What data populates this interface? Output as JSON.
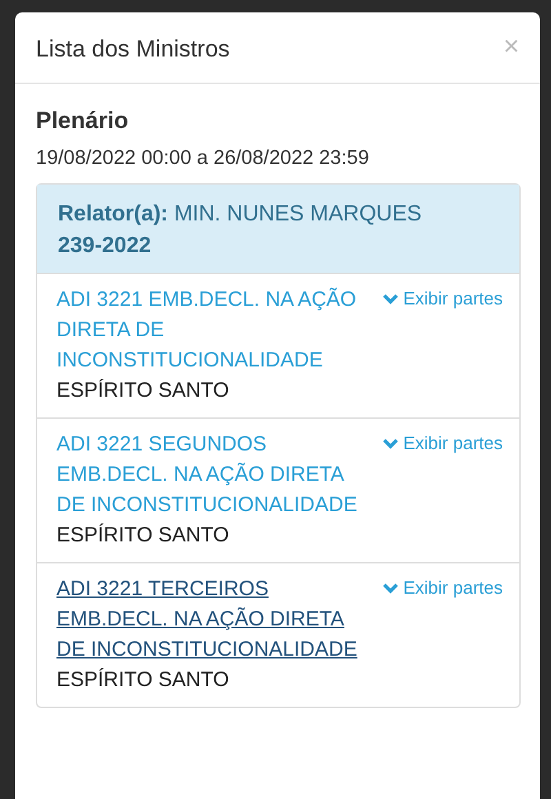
{
  "modal": {
    "title": "Lista dos Ministros",
    "close": "×"
  },
  "session": {
    "title": "Plenário",
    "period": "19/08/2022 00:00 a 26/08/2022 23:59"
  },
  "group": {
    "header": "**Relator(a):** MIN. NUNES MARQUES",
    "number": "239-2022"
  },
  "cases": [
    {
      "title": "ADI 3221 EMB.DECL. NA AÇÃO DIRETA DE INCONSTITUCIONALIDADE",
      "state": "ESPÍRITO SANTO",
      "toggle": "Exibir partes",
      "hovered": false
    },
    {
      "title": "ADI 3221 SEGUNDOS EMB.DECL. NA AÇÃO DIRETA DE INCONSTITUCIONALIDADE",
      "state": "ESPÍRITO SANTO",
      "toggle": "Exibir partes",
      "hovered": false
    },
    {
      "title": "ADI 3221 TERCEIROS EMB.DECL. NA AÇÃO DIRETA DE INCONSTITUCIONALIDADE",
      "state": "ESPÍRITO SANTO",
      "toggle": "Exibir partes",
      "hovered": true
    }
  ]
}
